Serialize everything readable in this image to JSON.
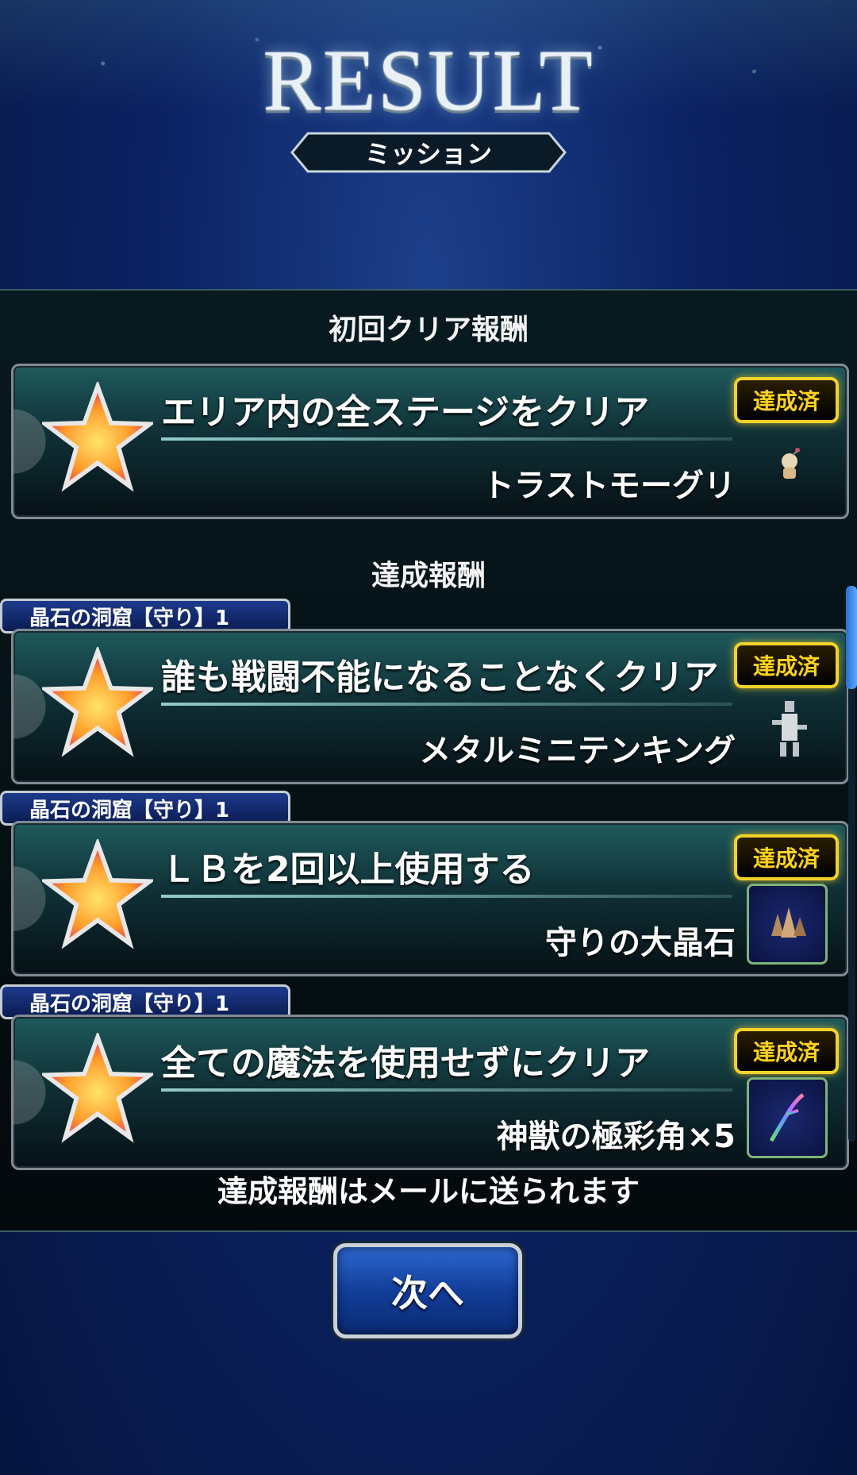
{
  "header": {
    "title": "RESULT",
    "subtitle": "ミッション"
  },
  "first_clear": {
    "section_title": "初回クリア報酬",
    "mission": {
      "text": "エリア内の全ステージをクリア",
      "status": "達成済",
      "reward": "トラストモーグリ",
      "reward_icon": "moogle-icon"
    }
  },
  "achievement": {
    "section_title": "達成報酬",
    "missions": [
      {
        "tag": "晶石の洞窟【守り】1",
        "text": "誰も戦闘不能になることなくクリア",
        "status": "達成済",
        "reward": "メタルミニテンキング",
        "reward_icon": "metal-cactuar-icon"
      },
      {
        "tag": "晶石の洞窟【守り】1",
        "text": "ＬＢを2回以上使用する",
        "status": "達成済",
        "reward": "守りの大晶石",
        "reward_icon": "crystal-icon"
      },
      {
        "tag": "晶石の洞窟【守り】1",
        "text": "全ての魔法を使用せずにクリア",
        "status": "達成済",
        "reward": "神獣の極彩角×5",
        "reward_icon": "horn-icon"
      }
    ]
  },
  "footer_note": "達成報酬はメールに送られます",
  "next_button": "次へ",
  "colors": {
    "accent_gold": "#f2d22b",
    "panel_teal": "#1f5a5c",
    "button_blue": "#2d67d0"
  }
}
